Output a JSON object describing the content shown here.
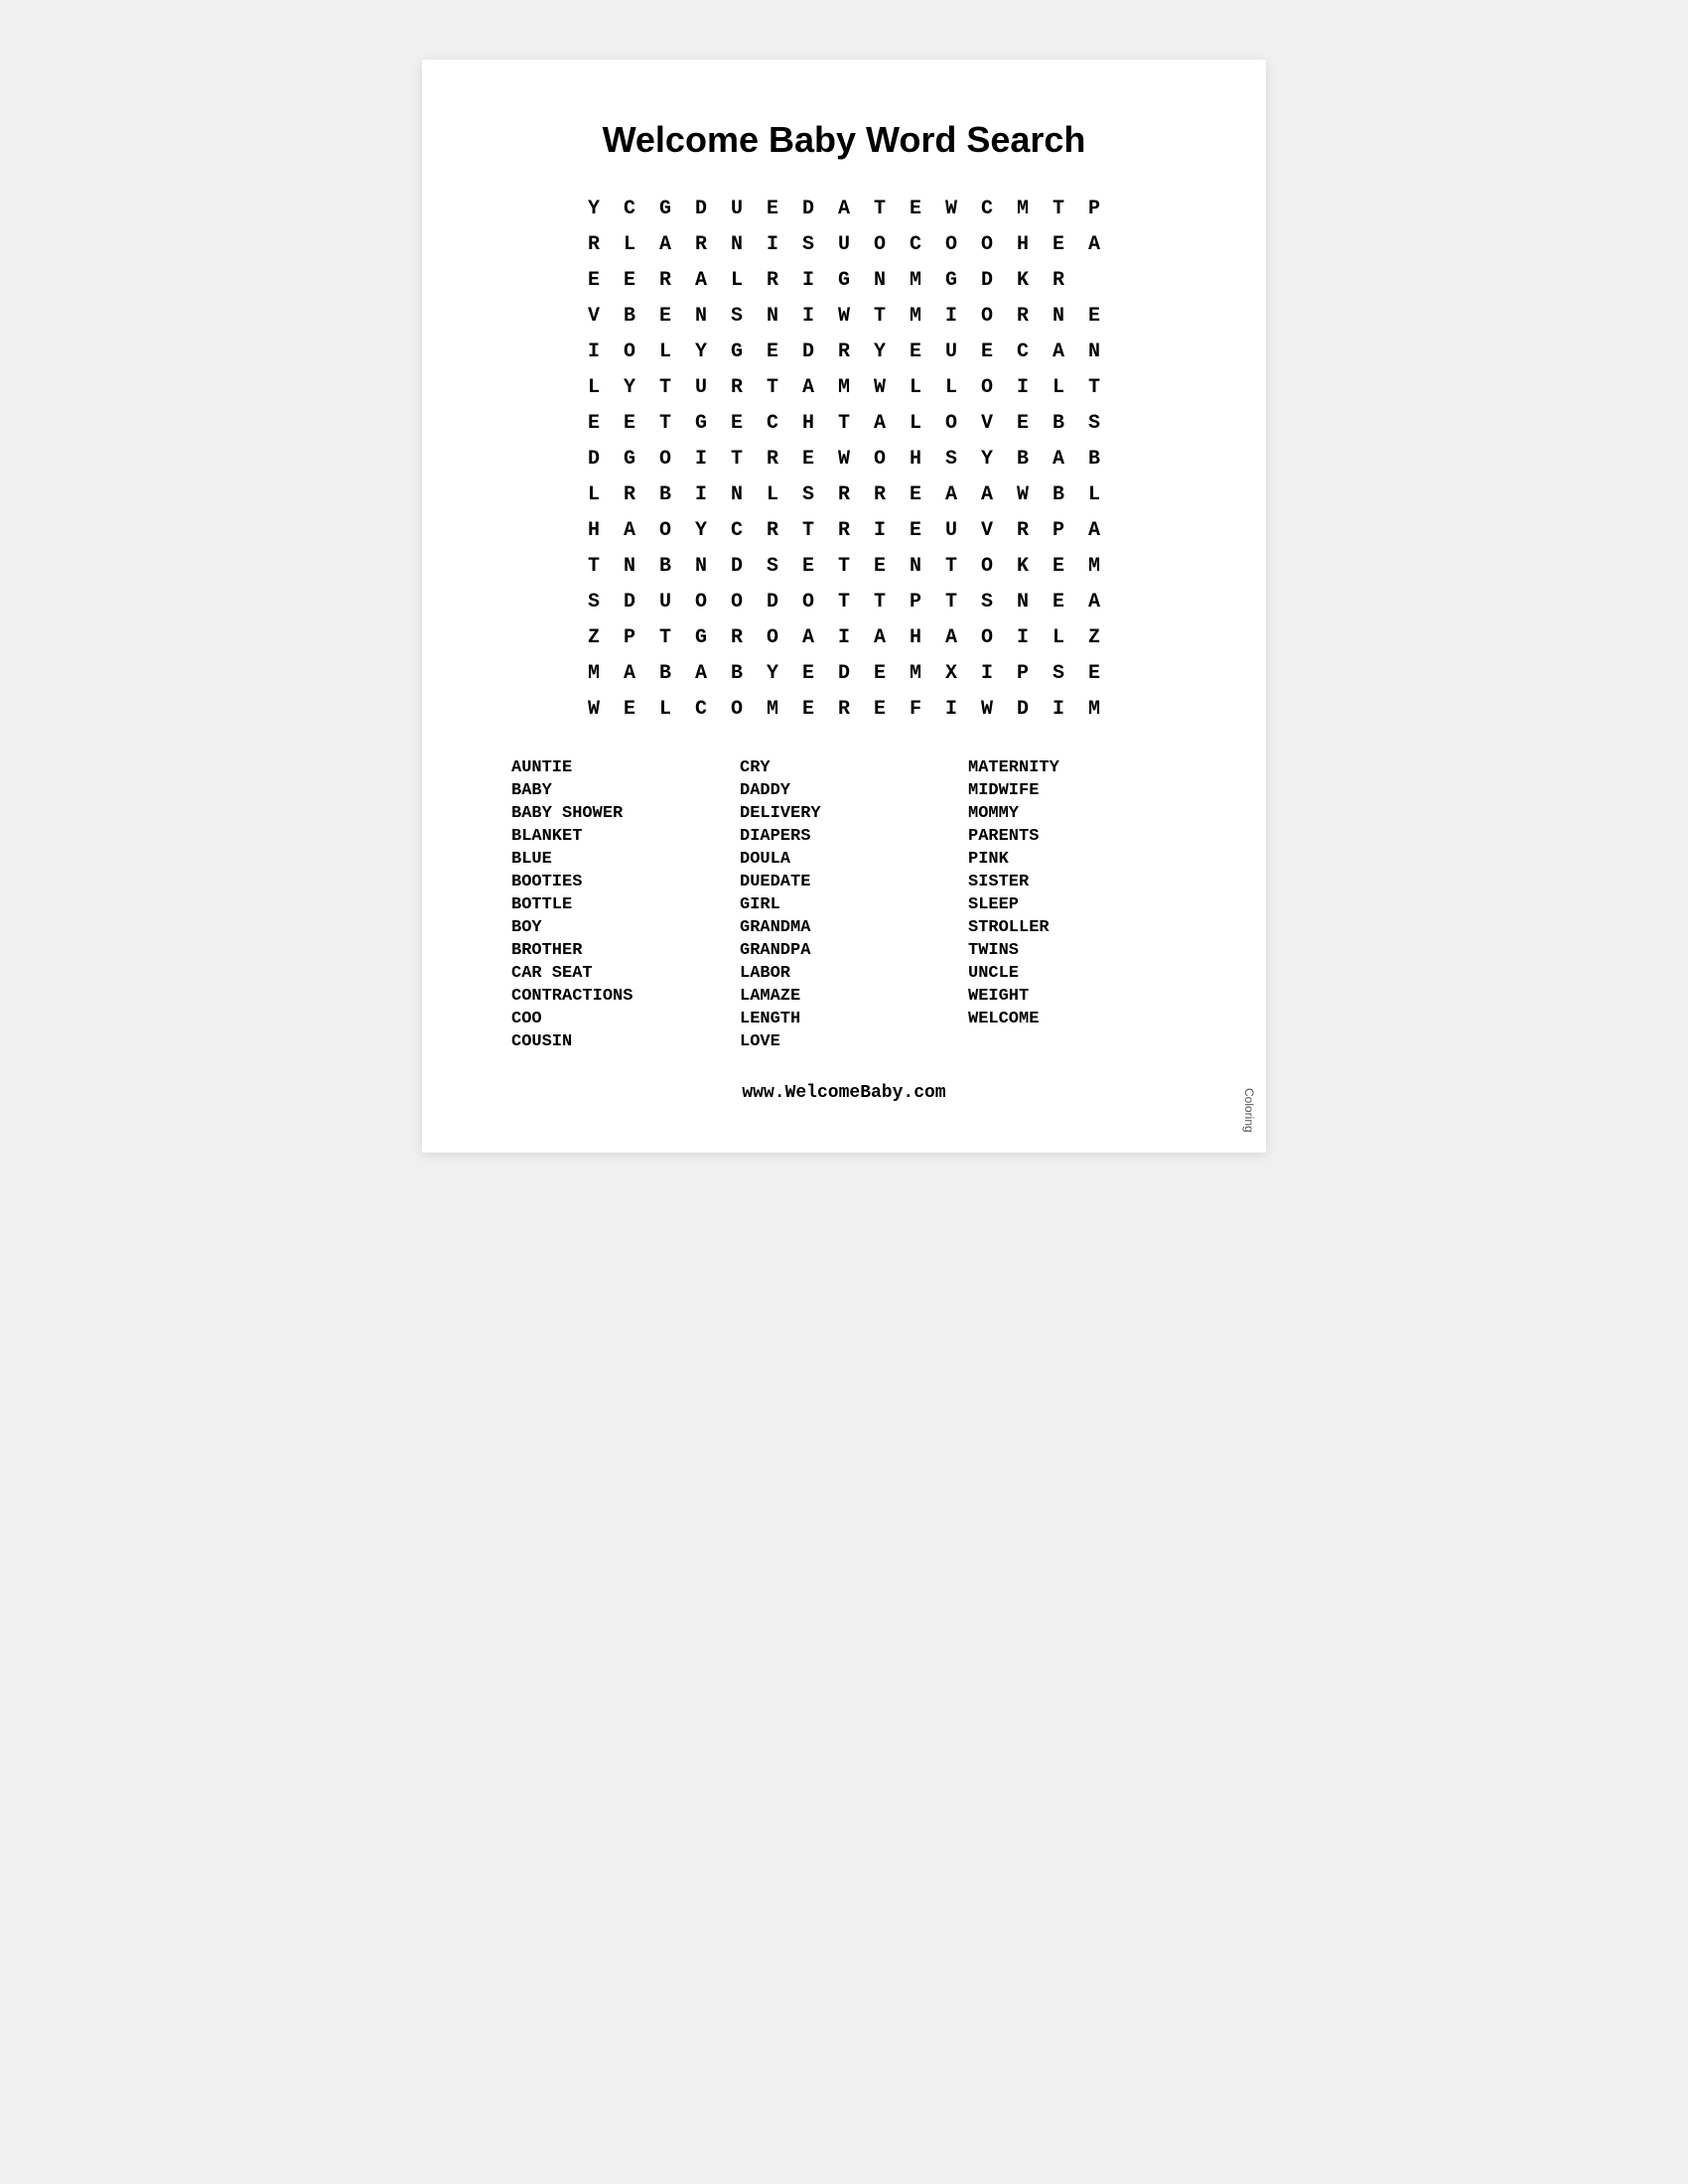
{
  "page": {
    "title": "Welcome Baby Word Search",
    "grid": [
      [
        "Y",
        "C",
        "G",
        "D",
        "U",
        "E",
        "D",
        "A",
        "T",
        "E",
        "W",
        "C",
        "M",
        "T",
        "P"
      ],
      [
        "R",
        "L",
        "A",
        "R",
        "N",
        "I",
        "S",
        "U",
        "O",
        "C",
        "O",
        "O",
        "H",
        "E",
        "A"
      ],
      [
        "E",
        "E",
        "R",
        "A",
        "L",
        "R",
        "I",
        "G",
        "N",
        "M",
        "G",
        "D",
        "K",
        "R",
        ""
      ],
      [
        "V",
        "B",
        "E",
        "N",
        "S",
        "N",
        "I",
        "W",
        "T",
        "M",
        "I",
        "O",
        "R",
        "N",
        "E"
      ],
      [
        "I",
        "O",
        "L",
        "Y",
        "G",
        "E",
        "D",
        "R",
        "Y",
        "E",
        "U",
        "E",
        "C",
        "A",
        "N"
      ],
      [
        "L",
        "Y",
        "T",
        "U",
        "R",
        "T",
        "A",
        "M",
        "W",
        "L",
        "L",
        "O",
        "I",
        "L",
        "T"
      ],
      [
        "E",
        "E",
        "T",
        "G",
        "E",
        "C",
        "H",
        "T",
        "A",
        "L",
        "O",
        "V",
        "E",
        "B",
        "S"
      ],
      [
        "D",
        "G",
        "O",
        "I",
        "T",
        "R",
        "E",
        "W",
        "O",
        "H",
        "S",
        "Y",
        "B",
        "A",
        "B"
      ],
      [
        "L",
        "R",
        "B",
        "I",
        "N",
        "L",
        "S",
        "R",
        "R",
        "E",
        "A",
        "A",
        "W",
        "B",
        "L"
      ],
      [
        "H",
        "A",
        "O",
        "Y",
        "C",
        "R",
        "T",
        "R",
        "I",
        "E",
        "U",
        "V",
        "R",
        "P",
        "A"
      ],
      [
        "T",
        "N",
        "B",
        "N",
        "D",
        "S",
        "E",
        "T",
        "E",
        "N",
        "T",
        "O",
        "K",
        "E",
        "M"
      ],
      [
        "S",
        "D",
        "U",
        "O",
        "O",
        "D",
        "O",
        "T",
        "T",
        "P",
        "T",
        "S",
        "N",
        "E",
        "A"
      ],
      [
        "Z",
        "P",
        "T",
        "G",
        "R",
        "O",
        "A",
        "I",
        "A",
        "H",
        "A",
        "O",
        "I",
        "L",
        "Z"
      ],
      [
        "M",
        "A",
        "B",
        "A",
        "B",
        "Y",
        "E",
        "D",
        "E",
        "M",
        "X",
        "I",
        "P",
        "S",
        "E"
      ],
      [
        "W",
        "E",
        "L",
        "C",
        "O",
        "M",
        "E",
        "R",
        "E",
        "F",
        "I",
        "W",
        "D",
        "I",
        "M"
      ]
    ],
    "words": {
      "col1": [
        "AUNTIE",
        "BABY",
        "BABY SHOWER",
        "BLANKET",
        "BLUE",
        "BOOTIES",
        "BOTTLE",
        "BOY",
        "BROTHER",
        "CAR SEAT",
        "CONTRACTIONS",
        "COO",
        "COUSIN"
      ],
      "col2": [
        "CRY",
        "DADDY",
        "DELIVERY",
        "DIAPERS",
        "DOULA",
        "DUEDATE",
        "GIRL",
        "GRANDMA",
        "GRANDPA",
        "LABOR",
        "LAMAZE",
        "LENGTH",
        "LOVE"
      ],
      "col3": [
        "MATERNITY",
        "MIDWIFE",
        "MOMMY",
        "PARENTS",
        "PINK",
        "SISTER",
        "SLEEP",
        "STROLLER",
        "TWINS",
        "UNCLE",
        "WEIGHT",
        "WELCOME"
      ]
    },
    "footer": "www.WelcomeBaby.com",
    "coloring_label": "Coloring"
  }
}
